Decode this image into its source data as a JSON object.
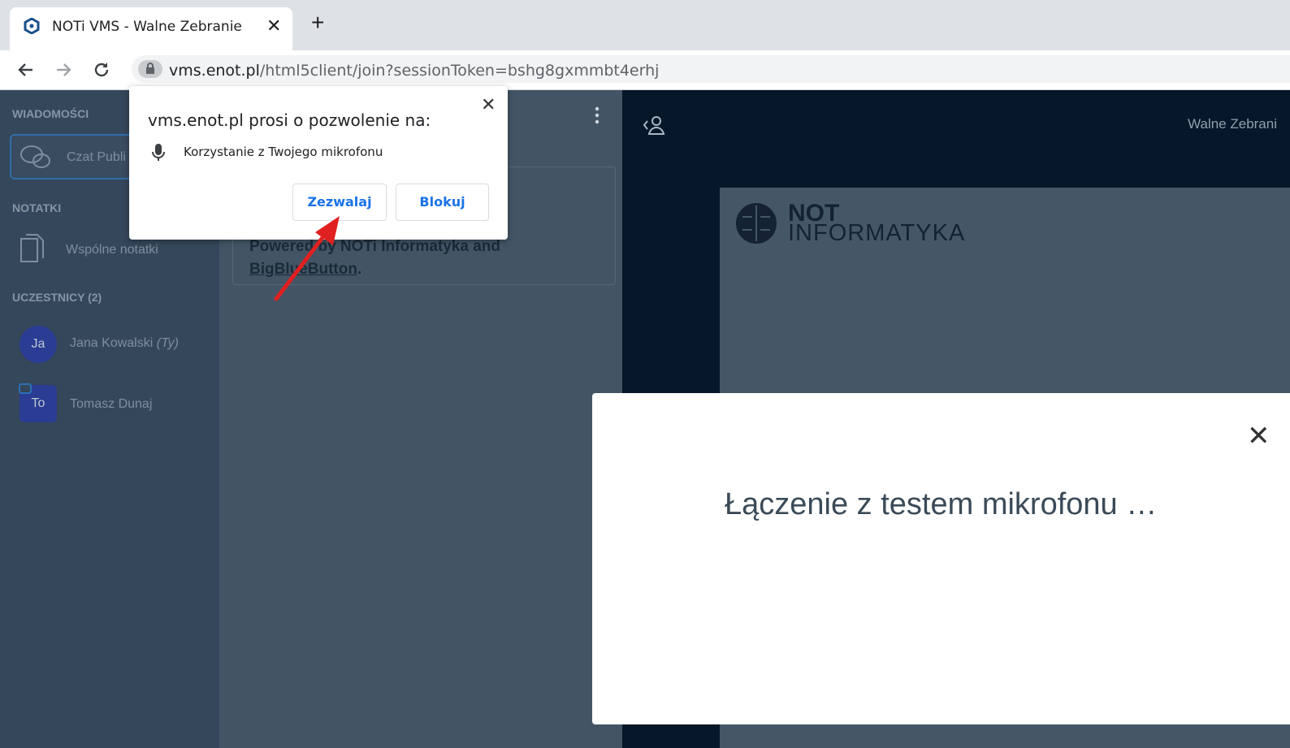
{
  "browser": {
    "tab_title": "NOTi VMS - Walne Zebranie",
    "tab_close": "✕",
    "new_tab": "+",
    "url_host": "vms.enot.pl",
    "url_path": "/html5client/join?sessionToken=bshg8gxmmbt4erhj"
  },
  "sidebar": {
    "messages_label": "WIADOMOŚCI",
    "public_chat": "Czat Publi",
    "notes_label": "NOTATKI",
    "shared_notes": "Wspólne notatki",
    "participants_label": "UCZESTNICY (2)",
    "users": [
      {
        "initials": "Ja",
        "name": "Jana Kowalski",
        "you": "(Ty)"
      },
      {
        "initials": "To",
        "name": "Tomasz Dunaj"
      }
    ]
  },
  "chat": {
    "welcome_line1": "Powered by NOTi Informatyka and",
    "welcome_link": "BigBlueButton",
    "welcome_tail": "."
  },
  "presentation": {
    "meeting_title": "Walne Zebrani",
    "logo_line1": "NOT",
    "logo_line2": "INFORMATYKA"
  },
  "modal": {
    "close": "✕",
    "message": "Łączenie z testem mikrofonu …"
  },
  "permission": {
    "title": "vms.enot.pl prosi o pozwolenie na:",
    "description": "Korzystanie z Twojego mikrofonu",
    "allow": "Zezwalaj",
    "block": "Blokuj",
    "close": "✕"
  },
  "colors": {
    "accent": "#1a73e8",
    "annotation_arrow": "#e02020",
    "sidebar_bg": "#35475a",
    "navy_bg": "#061729"
  }
}
